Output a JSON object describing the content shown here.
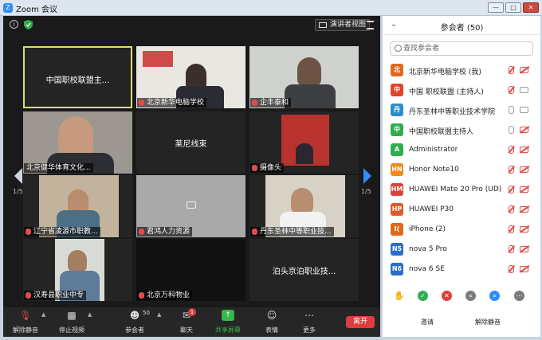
{
  "window": {
    "title": "Zoom 会议",
    "app_icon": "Z"
  },
  "meeting_header": {
    "speaker_view_label": "演讲者视图",
    "icons": [
      "info-icon",
      "shield-icon",
      "fullscreen-icon"
    ]
  },
  "gallery": {
    "page_left": "1/5",
    "page_right": "1/5",
    "tiles": [
      {
        "name": "中国职校联盟主...",
        "video": false,
        "active": true,
        "muted": false
      },
      {
        "name": "北京新华电脑学校",
        "video": true,
        "active": false,
        "muted": true
      },
      {
        "name": "企丰泰和",
        "video": true,
        "active": false,
        "muted": true
      },
      {
        "name": "北京健华体育文化...",
        "video": true,
        "active": false,
        "muted": false
      },
      {
        "name": "莱尼线束",
        "video": false,
        "active": false,
        "muted": false
      },
      {
        "name": "摄像头",
        "video": true,
        "active": false,
        "muted": true
      },
      {
        "name": "辽宁省凌源市职教...",
        "video": true,
        "active": false,
        "muted": true
      },
      {
        "name": "君鸿人力资源",
        "video": true,
        "active": false,
        "muted": true
      },
      {
        "name": "丹东圣林中等职业技...",
        "video": true,
        "active": false,
        "muted": true
      },
      {
        "name": "汉寿县职业中专",
        "video": true,
        "active": false,
        "muted": true
      },
      {
        "name": "北京万科物业",
        "video": false,
        "active": false,
        "muted": true
      },
      {
        "name": "泊头京泊职业技...",
        "video": false,
        "active": false,
        "muted": false
      }
    ]
  },
  "toolbar": {
    "mute_label": "解除静音",
    "video_label": "停止视频",
    "participants_label": "参会者",
    "participants_count": "50",
    "chat_label": "聊天",
    "chat_badge": "1",
    "share_label": "共享屏幕",
    "reactions_label": "表情",
    "more_label": "更多",
    "leave_label": "离开",
    "share_color": "#35b84c",
    "leave_color": "#e03c3c"
  },
  "panel": {
    "title": "参会者 (50)",
    "search_placeholder": "查找参会者",
    "participants": [
      {
        "avatar": "北",
        "color": "#e06a1b",
        "name": "北京新华电脑学校 (我)",
        "mic": "muted",
        "cam": "off"
      },
      {
        "avatar": "中",
        "color": "#e0452b",
        "name": "中国 职校联盟 (主持人)",
        "mic": "muted",
        "cam": "on"
      },
      {
        "avatar": "丹",
        "color": "#2a8fc7",
        "name": "丹东圣林中等职业技术学院",
        "mic": "on",
        "cam": "on"
      },
      {
        "avatar": "中",
        "color": "#2fae4f",
        "name": "中国职校联盟主持人",
        "mic": "on",
        "cam": "off"
      },
      {
        "avatar": "A",
        "color": "#2fae4f",
        "name": "Administrator",
        "mic": "muted",
        "cam": "off"
      },
      {
        "avatar": "HN",
        "color": "#f08a1c",
        "name": "Honor Note10",
        "mic": "muted",
        "cam": "off"
      },
      {
        "avatar": "HM",
        "color": "#d9443a",
        "name": "HUAWEI Mate 20 Pro (UD)",
        "mic": "muted",
        "cam": "off"
      },
      {
        "avatar": "HP",
        "color": "#e0582b",
        "name": "HUAWEI P30",
        "mic": "muted",
        "cam": "off"
      },
      {
        "avatar": "I(",
        "color": "#e06a1b",
        "name": "iPhone (2)",
        "mic": "muted",
        "cam": "off"
      },
      {
        "avatar": "N5",
        "color": "#2a6fc7",
        "name": "nova 5 Pro",
        "mic": "muted",
        "cam": "off"
      },
      {
        "avatar": "N6",
        "color": "#2a6fc7",
        "name": "nova 6 SE",
        "mic": "muted",
        "cam": "off"
      }
    ],
    "invite_label": "邀请",
    "unmute_all_label": "解除静音"
  }
}
